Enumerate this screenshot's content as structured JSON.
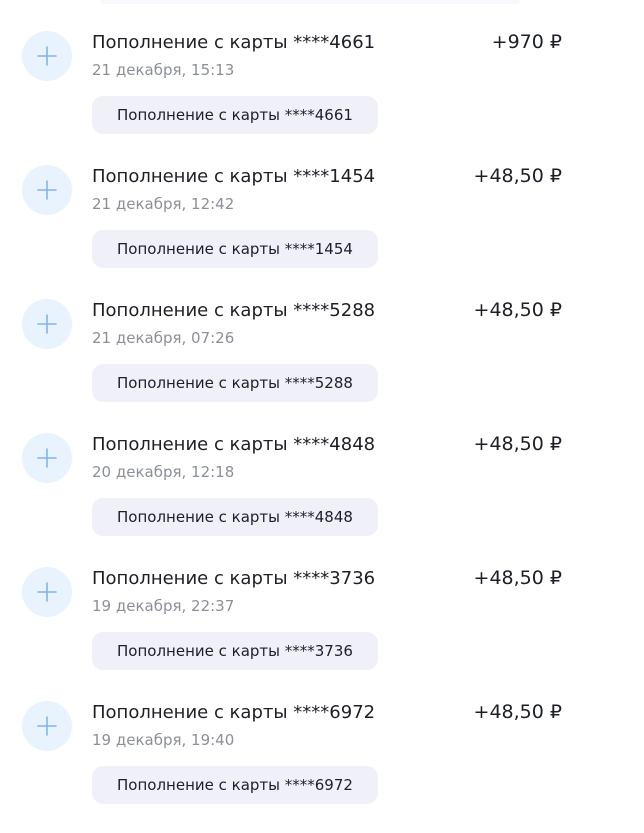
{
  "transactions": [
    {
      "title": "Пополнение с карты ****4661",
      "date": "21 декабря, 15:13",
      "amount": "+970 ₽",
      "chip": "Пополнение с карты ****4661",
      "icon": "plus-icon"
    },
    {
      "title": "Пополнение с карты ****1454",
      "date": "21 декабря, 12:42",
      "amount": "+48,50 ₽",
      "chip": "Пополнение с карты ****1454",
      "icon": "plus-icon"
    },
    {
      "title": "Пополнение с карты ****5288",
      "date": "21 декабря, 07:26",
      "amount": "+48,50 ₽",
      "chip": "Пополнение с карты ****5288",
      "icon": "plus-icon"
    },
    {
      "title": "Пополнение с карты ****4848",
      "date": "20 декабря, 12:18",
      "amount": "+48,50 ₽",
      "chip": "Пополнение с карты ****4848",
      "icon": "plus-icon"
    },
    {
      "title": "Пополнение с карты ****3736",
      "date": "19 декабря, 22:37",
      "amount": "+48,50 ₽",
      "chip": "Пополнение с карты ****3736",
      "icon": "plus-icon"
    },
    {
      "title": "Пополнение с карты ****6972",
      "date": "19 декабря, 19:40",
      "amount": "+48,50 ₽",
      "chip": "Пополнение с карты ****6972",
      "icon": "plus-icon"
    }
  ],
  "colors": {
    "icon_bg": "#e8f3fd",
    "icon_plus": "#7fb6ea",
    "chip_bg": "#f0f1f8",
    "date_text": "#8b8f99"
  }
}
